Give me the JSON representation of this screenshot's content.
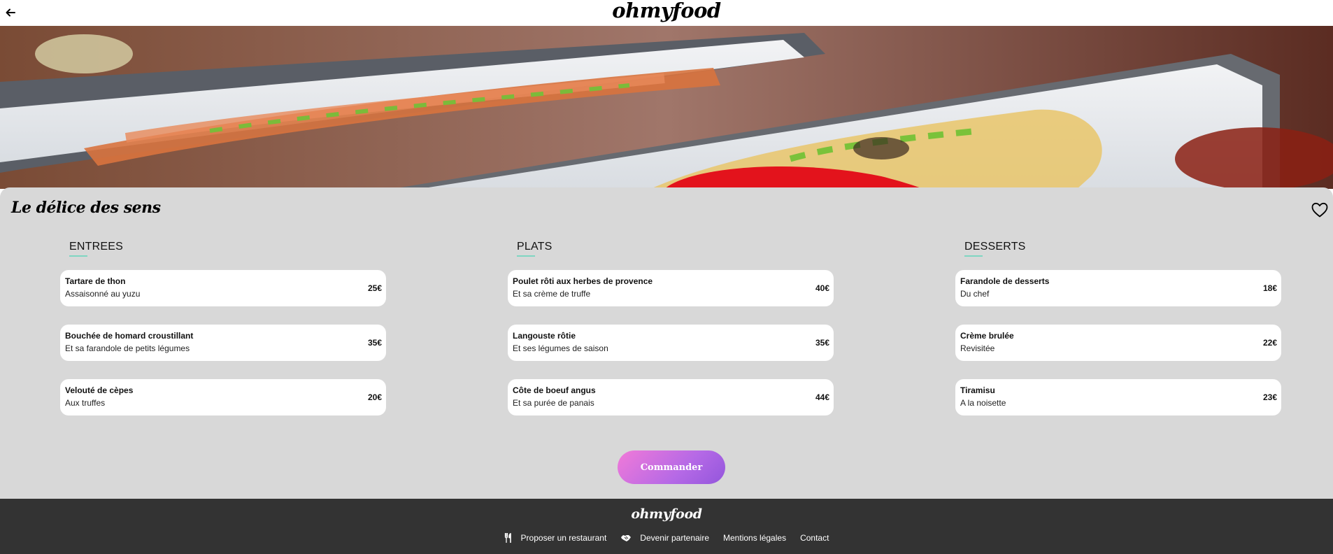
{
  "header": {
    "back_icon": "arrow-left-icon",
    "logo": "ohmyfood"
  },
  "restaurant": {
    "name": "Le délice des sens",
    "heart_icon": "heart-icon"
  },
  "menu": {
    "columns": [
      {
        "title": "ENTREES",
        "items": [
          {
            "name": "Tartare de thon",
            "desc": "Assaisonné au yuzu",
            "price": "25€"
          },
          {
            "name": "Bouchée de homard croustillant",
            "desc": "Et sa farandole de petits légumes",
            "price": "35€"
          },
          {
            "name": "Velouté de cèpes",
            "desc": "Aux truffes",
            "price": "20€"
          }
        ]
      },
      {
        "title": "PLATS",
        "items": [
          {
            "name": "Poulet rôti aux herbes de provence",
            "desc": "Et sa crème de truffe",
            "price": "40€"
          },
          {
            "name": "Langouste rôtie",
            "desc": "Et ses légumes de saison",
            "price": "35€"
          },
          {
            "name": "Côte de boeuf angus",
            "desc": "Et sa purée de panais",
            "price": "44€"
          }
        ]
      },
      {
        "title": "DESSERTS",
        "items": [
          {
            "name": "Farandole de desserts",
            "desc": "Du chef",
            "price": "18€"
          },
          {
            "name": "Crème brulée",
            "desc": "Revisitée",
            "price": "22€"
          },
          {
            "name": "Tiramisu",
            "desc": "A la noisette",
            "price": "23€"
          }
        ]
      }
    ],
    "order_label": "Commander"
  },
  "footer": {
    "logo": "ohmyfood",
    "links": [
      {
        "label": "Proposer un restaurant",
        "icon": "utensils-icon"
      },
      {
        "label": "Devenir partenaire",
        "icon": "handshake-icon"
      },
      {
        "label": "Mentions légales"
      },
      {
        "label": "Contact"
      }
    ]
  },
  "colors": {
    "menu_bg": "#d8d8d8",
    "footer_bg": "#333333",
    "accent_underline": "#7fd6c2",
    "button_gradient_start": "#f17ad8",
    "button_gradient_end": "#9356dc"
  }
}
